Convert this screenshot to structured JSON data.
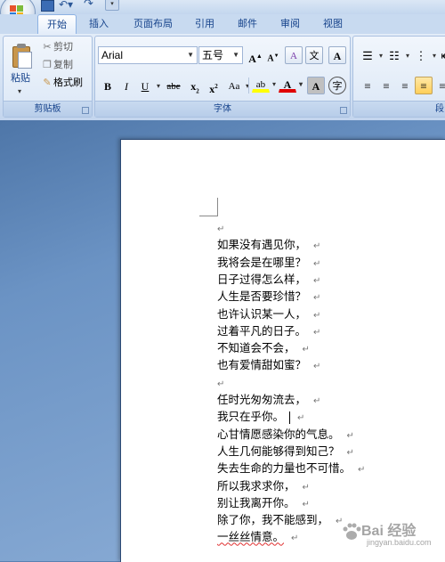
{
  "ribbon": {
    "tabs": [
      {
        "label": "开始",
        "active": true
      },
      {
        "label": "插入"
      },
      {
        "label": "页面布局"
      },
      {
        "label": "引用"
      },
      {
        "label": "邮件"
      },
      {
        "label": "审阅"
      },
      {
        "label": "视图"
      }
    ],
    "clipboard": {
      "paste_label": "粘贴",
      "cut_label": "剪切",
      "copy_label": "复制",
      "format_painter_label": "格式刷",
      "group_label": "剪贴板"
    },
    "font": {
      "font_name": "Arial",
      "font_size": "五号",
      "group_label": "字体",
      "buttons": {
        "grow": "A",
        "shrink": "A",
        "clear": "A",
        "phonetic": "文",
        "border": "A",
        "bold": "B",
        "italic": "I",
        "underline": "U",
        "strike": "abe",
        "subscript": "x",
        "superscript": "x",
        "case": "Aa",
        "font_color": "A",
        "shade": "A",
        "enclose": "字"
      }
    },
    "paragraph": {
      "group_label": "段"
    }
  },
  "document": {
    "lines": [
      "",
      "如果没有遇见你，",
      "我将会是在哪里？",
      "日子过得怎么样，",
      "人生是否要珍惜？",
      "也许认识某一人，",
      "过着平凡的日子。",
      "不知道会不会，",
      "也有爱情甜如蜜？",
      "",
      "任时光匆匆流去，",
      "我只在乎你。",
      "心甘情愿感染你的气息。",
      "人生几何能够得到知己？",
      "失去生命的力量也不可惜。",
      "所以我求求你，",
      "别让我离开你。",
      "除了你，我不能感到，",
      "一丝丝情意。"
    ],
    "pilcrow": "↵"
  },
  "watermark": {
    "text": "Bai 经验",
    "sub": "jingyan.baidu.com"
  },
  "colors": {
    "ribbon_text": "#15428b",
    "font_color_bar": "#e00000",
    "highlight_bar": "#ffff00",
    "spell_error": "#e03030"
  }
}
